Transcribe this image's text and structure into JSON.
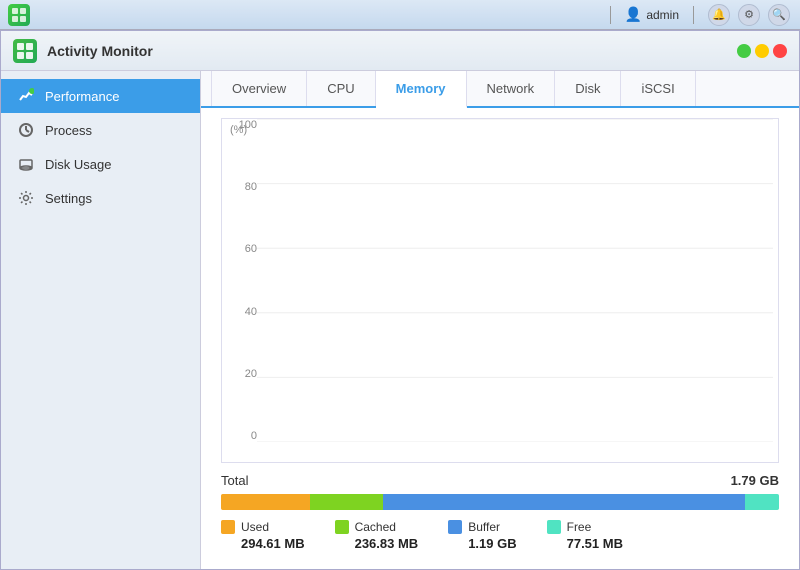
{
  "titlebar": {
    "app_icon": "≡",
    "user_icon": "👤",
    "username": "admin",
    "separator": true,
    "notification_icon": "🔔",
    "settings_icon": "⚙",
    "search_icon": "🔍"
  },
  "app": {
    "icon": "📊",
    "title": "Activity Monitor"
  },
  "window_buttons": {
    "green_label": "",
    "yellow_label": "",
    "red_label": ""
  },
  "sidebar": {
    "items": [
      {
        "id": "performance",
        "label": "Performance",
        "icon": "📈",
        "active": true
      },
      {
        "id": "process",
        "label": "Process",
        "icon": "🔄",
        "active": false
      },
      {
        "id": "disk-usage",
        "label": "Disk Usage",
        "icon": "💾",
        "active": false
      },
      {
        "id": "settings",
        "label": "Settings",
        "icon": "⚙",
        "active": false
      }
    ]
  },
  "tabs": [
    {
      "id": "overview",
      "label": "Overview",
      "active": false
    },
    {
      "id": "cpu",
      "label": "CPU",
      "active": false
    },
    {
      "id": "memory",
      "label": "Memory",
      "active": true
    },
    {
      "id": "network",
      "label": "Network",
      "active": false
    },
    {
      "id": "disk",
      "label": "Disk",
      "active": false
    },
    {
      "id": "iscsi",
      "label": "iSCSI",
      "active": false
    }
  ],
  "chart": {
    "y_axis_label": "(%)",
    "y_labels": [
      "100",
      "80",
      "60",
      "40",
      "20",
      "0"
    ],
    "accent_color": "#3b9de8",
    "fill_color": "#a8d8f0"
  },
  "memory": {
    "total_label": "Total",
    "total_value": "1.79 GB",
    "bar": {
      "used_pct": 16,
      "cached_pct": 13,
      "buffer_pct": 65,
      "free_pct": 6
    },
    "legend": [
      {
        "id": "used",
        "label": "Used",
        "color": "#f5a623",
        "value": "294.61 MB"
      },
      {
        "id": "cached",
        "label": "Cached",
        "color": "#7ed321",
        "value": "236.83 MB"
      },
      {
        "id": "buffer",
        "label": "Buffer",
        "color": "#4a90e2",
        "value": "1.19 GB"
      },
      {
        "id": "free",
        "label": "Free",
        "color": "#50e3c2",
        "value": "77.51 MB"
      }
    ]
  }
}
